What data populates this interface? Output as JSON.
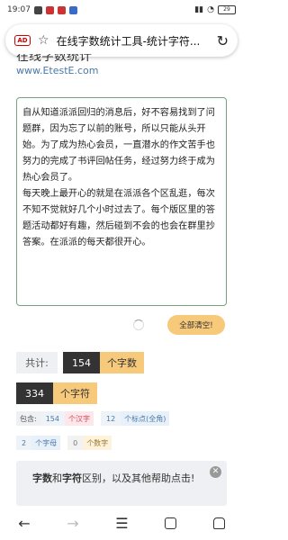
{
  "status": {
    "time": "19:07",
    "battery": "29"
  },
  "browser": {
    "title": "在线字数统计工具-统计字符..."
  },
  "site": {
    "name_partial": "在线字数统计",
    "url": "www.EtestE.com"
  },
  "editor": {
    "paragraphs": [
      "自从知道派派回归的消息后，好不容易找到了问题群，因为忘了以前的账号，所以只能从头开始。为了成为热心会员，一直潜水的作文苦手也努力的完成了书评回帖任务，经过努力终于成为热心会员了。",
      "每天晚上最开心的就是在派派各个区乱逛，每次不知不觉就好几个小时过去了。每个版区里的答题活动都好有趣，然后碰到不会的也会在群里抄答案。在派派的每天都很开心。"
    ]
  },
  "clear_button": "全部清空!",
  "counts": {
    "total_label": "共计:",
    "words": "154",
    "words_unit": "个字数",
    "chars": "334",
    "chars_unit": "个字符"
  },
  "breakdown": {
    "label": "包含:",
    "hanzi": "154",
    "hanzi_unit": "个汉字",
    "punct": "12",
    "punct_unit": "个标点(全角)",
    "letters": "2",
    "letters_unit": "个字母",
    "digits": "0",
    "digits_unit": "个数字"
  },
  "help": {
    "part1": "字数",
    "part2": "和",
    "part3": "字符",
    "part4": "区别，以及其他帮助点击!"
  },
  "colors": {
    "accent": "#f7c97a",
    "dark": "#333333",
    "editor_border": "#79a27f"
  }
}
